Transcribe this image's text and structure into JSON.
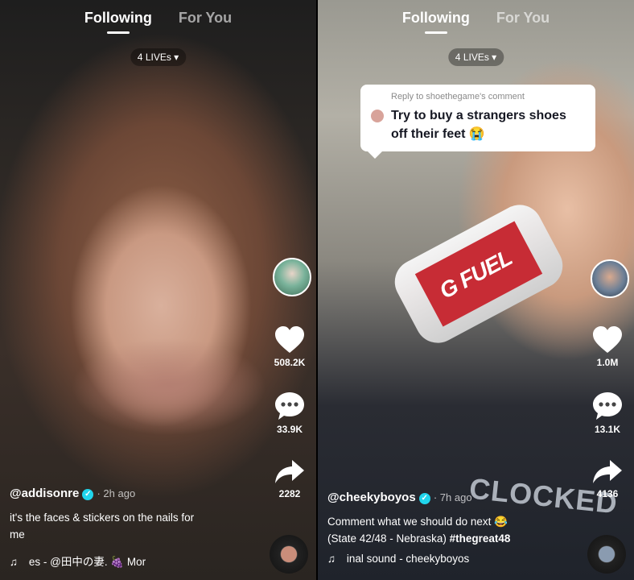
{
  "left": {
    "tabs": {
      "following": "Following",
      "for_you": "For You"
    },
    "lives": "4 LIVEs ▾",
    "likes": "508.2K",
    "comments": "33.9K",
    "shares": "2282",
    "username": "@addisonre",
    "time": "· 2h ago",
    "caption_line1": "it's the faces & stickers on the nails for",
    "caption_line2": "me",
    "music": "es - @田中の妻. 🍇     Mor"
  },
  "right": {
    "tabs": {
      "following": "Following",
      "for_you": "For You"
    },
    "lives": "4 LIVEs ▾",
    "reply_header": "Reply to shoethegame's comment",
    "reply_line1": "Try to buy a strangers shoes",
    "reply_line2": "off their feet 😭",
    "can_label": "G FUEL",
    "shirt_text": "CLOCKED",
    "likes": "1.0M",
    "comments": "13.1K",
    "shares": "4136",
    "username": "@cheekyboyos",
    "time": "· 7h ago",
    "caption_line1": "Comment what we should do next 😂",
    "caption_line2": "(State 42/48 - Nebraska) ",
    "caption_hashtag": "#thegreat48",
    "music": "inal sound - cheekyboyos"
  },
  "icons": {
    "music_note": "♫",
    "verified": "✓"
  },
  "colors": {
    "verified": "#20d5ec",
    "can_red": "#c72c35"
  }
}
